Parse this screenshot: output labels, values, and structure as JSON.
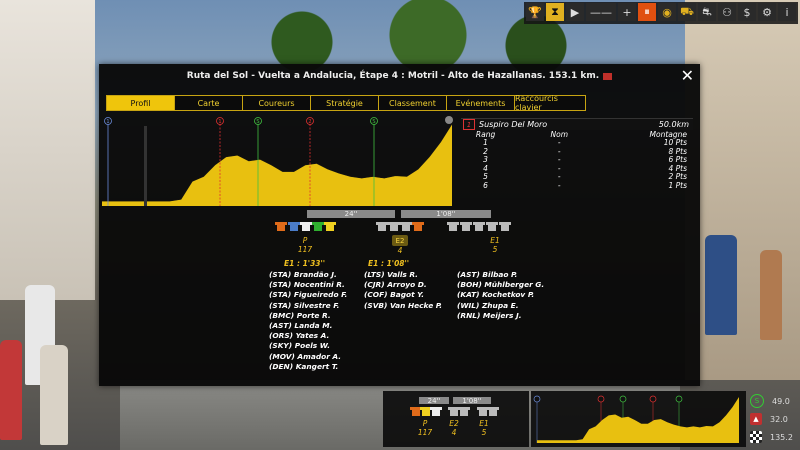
{
  "toolbar": {
    "icons": [
      "trophy-icon",
      "hourglass-icon",
      "play-icon",
      "minus-icon",
      "plus-icon",
      "pause-icon",
      "eye-icon",
      "team-car-icon",
      "race-car-icon",
      "binoculars-icon",
      "money-icon",
      "gear-icon",
      "info-icon"
    ],
    "separator": "——"
  },
  "panel": {
    "title": "Ruta del Sol - Vuelta a Andalucia, Étape 4 : Motril - Alto de Hazallanas. 153.1 km.",
    "close": "✕"
  },
  "tabs": [
    "Profil",
    "Carte",
    "Coureurs",
    "Stratégie",
    "Classement",
    "Evénements",
    "Raccourcis clavier"
  ],
  "profile_markers": [
    {
      "type": "start",
      "label": "1"
    },
    {
      "type": "climb",
      "label": "1"
    },
    {
      "type": "sprint",
      "label": "S"
    },
    {
      "type": "climb",
      "label": "2"
    },
    {
      "type": "sprint",
      "label": "S"
    }
  ],
  "profile_heights": [
    0.06,
    0.06,
    0.06,
    0.06,
    0.06,
    0.06,
    0.06,
    0.08,
    0.3,
    0.36,
    0.5,
    0.6,
    0.62,
    0.55,
    0.57,
    0.5,
    0.42,
    0.42,
    0.5,
    0.52,
    0.45,
    0.4,
    0.36,
    0.34,
    0.36,
    0.34,
    0.37,
    0.36,
    0.45,
    0.6,
    0.78,
    1.0
  ],
  "climb": {
    "number": "1",
    "name": "Suspiro Del Moro",
    "distance": "50.0km",
    "columns": {
      "rank": "Rang",
      "name": "Nom",
      "points": "Montagne"
    },
    "rows": [
      {
        "rank": "1",
        "name": "-",
        "points": "10 Pts"
      },
      {
        "rank": "2",
        "name": "-",
        "points": "8 Pts"
      },
      {
        "rank": "3",
        "name": "-",
        "points": "6 Pts"
      },
      {
        "rank": "4",
        "name": "-",
        "points": "4 Pts"
      },
      {
        "rank": "5",
        "name": "-",
        "points": "2 Pts"
      },
      {
        "rank": "6",
        "name": "-",
        "points": "1 Pts"
      }
    ]
  },
  "gaps": {
    "gap1": "24''",
    "gap2": "1'08''"
  },
  "groups": {
    "peloton": {
      "label": "P",
      "count": "117"
    },
    "escape2": {
      "label": "E2",
      "count": "4"
    },
    "escape1": {
      "label": "E1",
      "count": "5"
    }
  },
  "time_labels": {
    "peloton": "E1 : 1'33''",
    "escape2": "E1 : 1'08''"
  },
  "riders": {
    "peloton": [
      "(STA) Brandão J.",
      "(STA) Nocentini R.",
      "(STA) Figueiredo F.",
      "(STA) Silvestre F.",
      "(BMC) Porte R.",
      "(AST) Landa M.",
      "(ORS) Yates A.",
      "(SKY) Poels W.",
      "(MOV) Amador A.",
      "(DEN) Kangert T."
    ],
    "escape2": [
      "(LTS) Valls R.",
      "(CJR) Arroyo D.",
      "(COF) Bagot Y.",
      "(SVB) Van Hecke P."
    ],
    "escape1": [
      "(AST) Bilbao P.",
      "(BOH) Mühlberger G.",
      "(KAT) Kochetkov P.",
      "(WIL) Zhupa E.",
      "(RNL) Meijers J."
    ]
  },
  "mini": {
    "gap1": "24''",
    "gap2": "1'08''",
    "p_label": "P",
    "p_count": "117",
    "e2_label": "E2",
    "e2_count": "4",
    "e1_label": "E1",
    "e1_count": "5"
  },
  "stats": [
    {
      "icon": "speed-icon",
      "value": "49.0"
    },
    {
      "icon": "climb-icon",
      "value": "32.0"
    },
    {
      "icon": "finish-flag-icon",
      "value": "135.2"
    }
  ]
}
